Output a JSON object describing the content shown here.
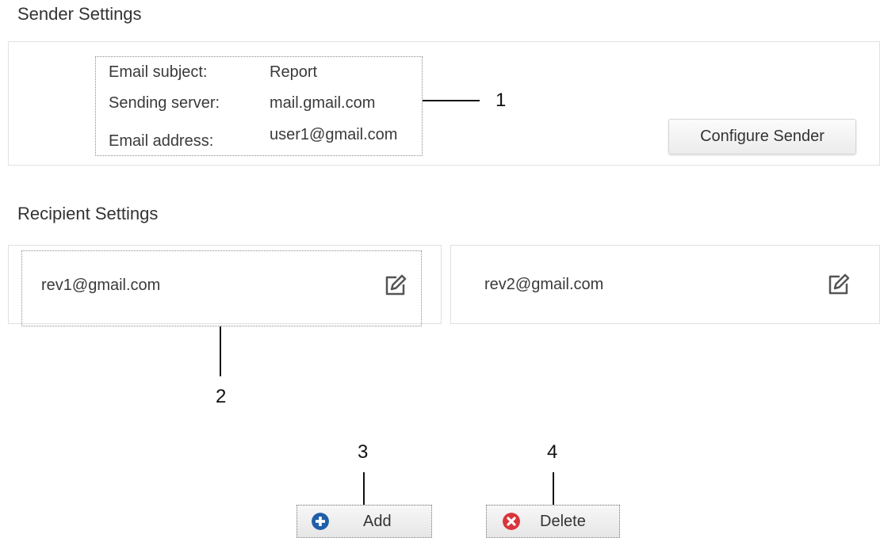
{
  "sender": {
    "title": "Sender Settings",
    "labels": {
      "subject": "Email subject:",
      "server": "Sending server:",
      "address": "Email address:"
    },
    "values": {
      "subject": "Report",
      "server": "mail.gmail.com",
      "address": "user1@gmail.com"
    },
    "configure_label": "Configure Sender"
  },
  "recipients": {
    "title": "Recipient Settings",
    "items": [
      {
        "email": "rev1@gmail.com",
        "icon": "edit-icon"
      },
      {
        "email": "rev2@gmail.com",
        "icon": "edit-icon"
      }
    ]
  },
  "actions": {
    "add_label": "Add",
    "add_icon": "plus-circle-icon",
    "add_color": "#1f5fa8",
    "delete_label": "Delete",
    "delete_icon": "x-circle-icon",
    "delete_color": "#d9353c"
  },
  "callouts": {
    "one": "1",
    "two": "2",
    "three": "3",
    "four": "4"
  }
}
